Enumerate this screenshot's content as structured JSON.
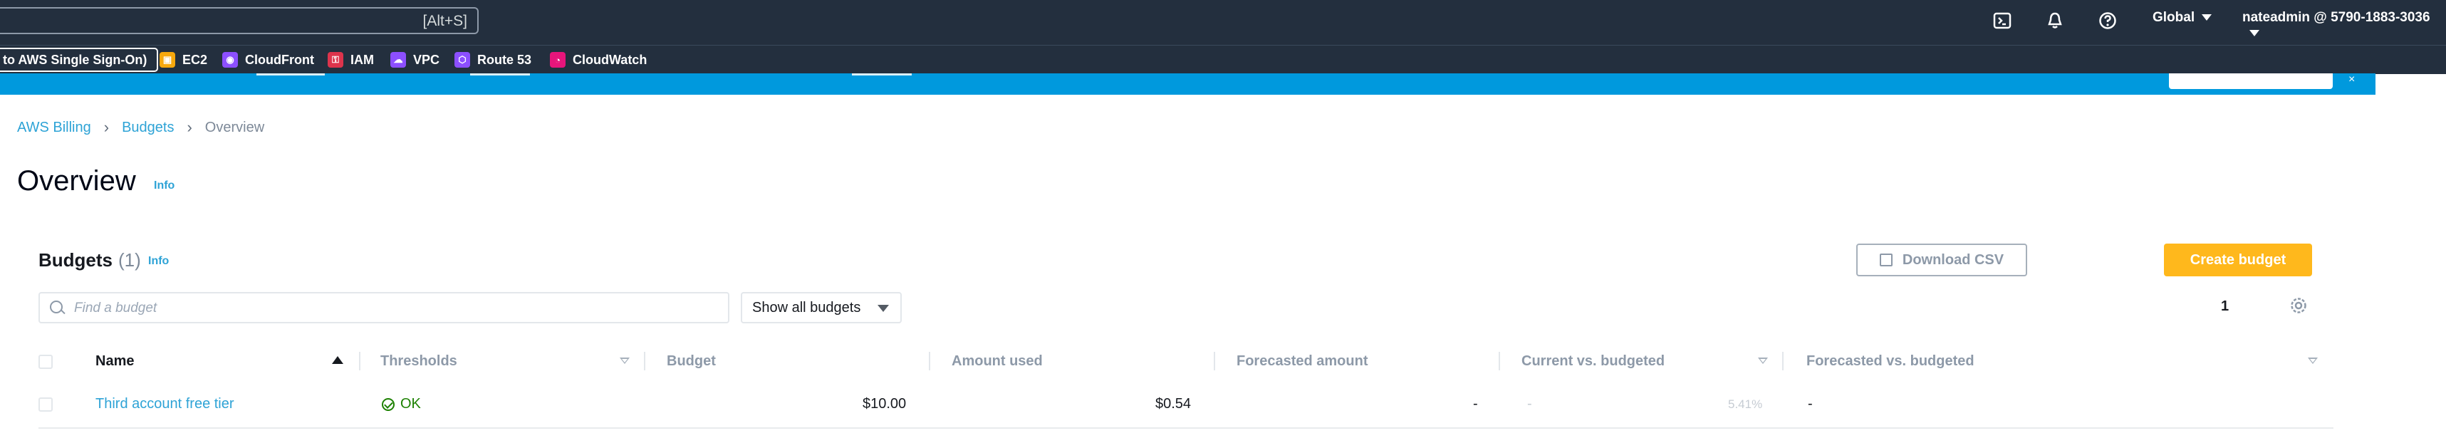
{
  "topnav": {
    "search_shortcut": "[Alt+S]",
    "region": "Global",
    "account": "nateadmin @ 5790-1883-3036",
    "icons": [
      "cloudshell-icon",
      "notifications-icon",
      "help-icon"
    ]
  },
  "favorites": [
    {
      "label": "to AWS Single Sign-On)",
      "icon": "none"
    },
    {
      "label": "EC2",
      "icon": "ec2-icon",
      "color": "#f7a80d"
    },
    {
      "label": "CloudFront",
      "icon": "cloudfront-icon",
      "color": "#8c4fff"
    },
    {
      "label": "IAM",
      "icon": "iam-icon",
      "color": "#dd344c"
    },
    {
      "label": "VPC",
      "icon": "vpc-icon",
      "color": "#8c4fff"
    },
    {
      "label": "Route 53",
      "icon": "route53-icon",
      "color": "#8c4fff"
    },
    {
      "label": "CloudWatch",
      "icon": "cloudwatch-icon",
      "color": "#e7157b"
    }
  ],
  "breadcrumb": {
    "items": [
      "AWS Billing",
      "Budgets",
      "Overview"
    ]
  },
  "page": {
    "title": "Overview",
    "info": "Info"
  },
  "budgets": {
    "title": "Budgets",
    "count": "(1)",
    "info": "Info",
    "download_label": "Download CSV",
    "create_label": "Create budget",
    "search_placeholder": "Find a budget",
    "filter_selected": "Show all budgets",
    "page_number": "1"
  },
  "table": {
    "columns": [
      "Name",
      "Thresholds",
      "Budget",
      "Amount used",
      "Forecasted amount",
      "Current vs. budgeted",
      "Forecasted vs. budgeted"
    ],
    "rows": [
      {
        "name": "Third account free tier",
        "thresholds": "OK",
        "budget": "$10.00",
        "amount_used": "$0.54",
        "forecasted_amount": "-",
        "current_vs_budgeted_dash": "-",
        "current_vs_budgeted": "5.41%",
        "forecasted_vs_budgeted": "-"
      }
    ]
  },
  "colors": {
    "nav_bg": "#232f3e",
    "banner": "#0099dd",
    "link": "#2ea3d6",
    "primary_button": "#ffb81c",
    "ok_status": "#1d8102"
  }
}
